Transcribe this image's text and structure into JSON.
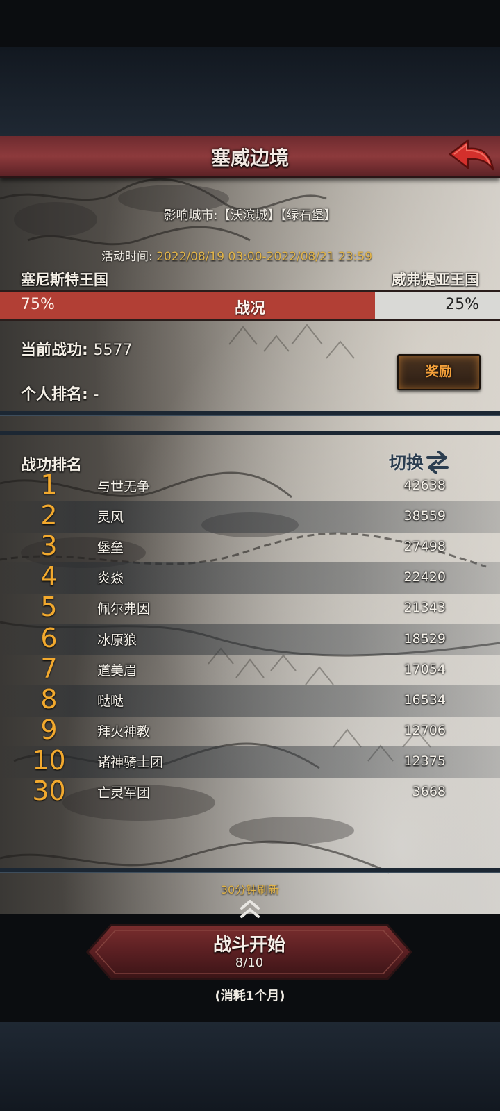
{
  "header": {
    "title": "塞威边境"
  },
  "info": {
    "influence_label": "影响城市:",
    "influence_cities": "【沃滨城】【绿石堡】",
    "event_time_label": "活动时间:",
    "event_time_value": "2022/08/19 03:00-2022/08/21 23:59"
  },
  "war": {
    "left_kingdom": "塞尼斯特王国",
    "right_kingdom": "威弗提亚王国",
    "left_percent_text": "75%",
    "center_label": "战况",
    "right_percent_text": "25%",
    "left_share": 0.75,
    "left_color": "#b23f35",
    "right_color": "#d9d9d6"
  },
  "player": {
    "merit_label": "当前战功:",
    "merit_value": "5577",
    "rank_label": "个人排名:",
    "rank_value": "-",
    "reward_button": "奖励"
  },
  "ranking": {
    "title": "战功排名",
    "switch_label": "切换",
    "rows": [
      {
        "rank": "1",
        "name": "与世无争",
        "score": "42638"
      },
      {
        "rank": "2",
        "name": "灵风",
        "score": "38559"
      },
      {
        "rank": "3",
        "name": "堡垒",
        "score": "27498"
      },
      {
        "rank": "4",
        "name": "炎焱",
        "score": "22420"
      },
      {
        "rank": "5",
        "name": "佩尔弗因",
        "score": "21343"
      },
      {
        "rank": "6",
        "name": "冰原狼",
        "score": "18529"
      },
      {
        "rank": "7",
        "name": "道美眉",
        "score": "17054"
      },
      {
        "rank": "8",
        "name": "哒哒",
        "score": "16534"
      },
      {
        "rank": "9",
        "name": "拜火神教",
        "score": "12706"
      },
      {
        "rank": "10",
        "name": "诸神骑士团",
        "score": "12375"
      },
      {
        "rank": "30",
        "name": "亡灵军团",
        "score": "3668"
      }
    ],
    "refresh_text": "30分钟刷新"
  },
  "battle": {
    "start_label": "战斗开始",
    "count": "8/10",
    "cost": "(消耗1个月)"
  },
  "icons": {
    "back": "back-arrow-icon",
    "switch": "swap-arrows-icon",
    "expand": "double-chevron-up-icon"
  },
  "colors": {
    "rank_number": "#f2a92e",
    "highlight_text": "#e1b44a",
    "reward_text": "#f4a03a",
    "title_bar": "#8d3a3c"
  }
}
